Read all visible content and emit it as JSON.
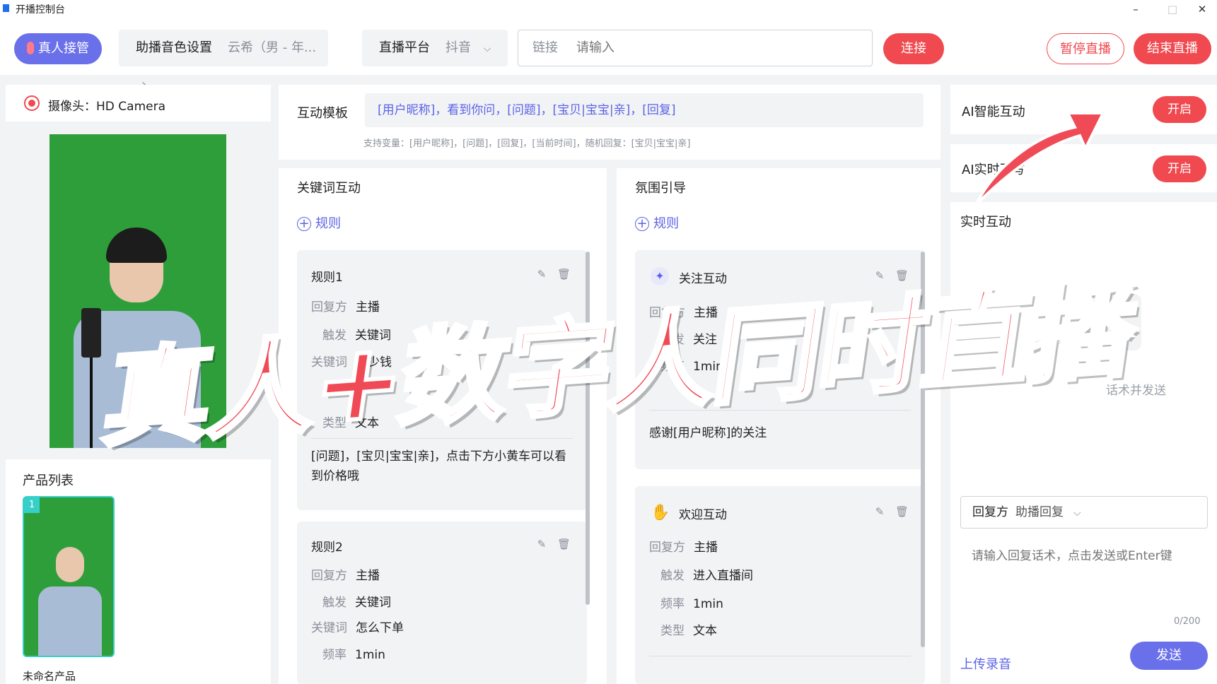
{
  "window": {
    "title": "开播控制台",
    "minimize": "–",
    "maximize": "□",
    "close": "✕"
  },
  "toolbar": {
    "real_person_label": "真人接管",
    "voice_label": "助播音色设置",
    "voice_value": "云希（男 - 年...",
    "platform_label": "直播平台",
    "platform_value": "抖音",
    "link_label": "链接",
    "link_placeholder": "请输入",
    "connect_label": "连接",
    "pause_label": "暂停直播",
    "end_label": "结束直播"
  },
  "camera": {
    "label": "摄像头：HD Camera"
  },
  "products": {
    "title": "产品列表",
    "items": [
      {
        "index": "1",
        "name": "未命名产品"
      }
    ]
  },
  "template": {
    "label": "互动模板",
    "value": "[用户昵称]，看到你问，[问题]，[宝贝|宝宝|亲]，[回复]",
    "hint": "支持变量：[用户昵称]，[问题]，[回复]，[当前时间]，随机回复：[宝贝|宝宝|亲]"
  },
  "keyword": {
    "title": "关键词互动",
    "add_rule": "规则",
    "rules": [
      {
        "title": "规则1",
        "reply_label": "回复方",
        "reply": "主播",
        "trigger_label": "触发",
        "trigger": "关键词",
        "keyword_label": "关键词",
        "keyword": "多少钱",
        "type_label": "类型",
        "type": "文本",
        "content": "[问题]，[宝贝|宝宝|亲]，点击下方小黄车可以看到价格哦"
      },
      {
        "title": "规则2",
        "reply_label": "回复方",
        "reply": "主播",
        "trigger_label": "触发",
        "trigger": "关键词",
        "keyword_label": "关键词",
        "keyword": "怎么下单",
        "freq_label": "频率",
        "freq": "1min"
      }
    ]
  },
  "atmosphere": {
    "title": "氛围引导",
    "add_rule": "规则",
    "cards": [
      {
        "title": "关注互动",
        "icon": "sparkle-icon",
        "reply_label": "回复方",
        "reply": "主播",
        "trigger_label": "触发",
        "trigger": "关注",
        "freq_label": "频率",
        "freq": "1min",
        "content": "感谢[用户昵称]的关注"
      },
      {
        "title": "欢迎互动",
        "icon": "clap-icon",
        "reply_label": "回复方",
        "reply": "主播",
        "trigger_label": "触发",
        "trigger": "进入直播间",
        "freq_label": "频率",
        "freq": "1min",
        "type_label": "类型",
        "type": "文本"
      }
    ]
  },
  "right": {
    "ai_interact": "AI智能互动",
    "ai_rewrite": "AI实时改写",
    "toggle_on": "开启",
    "realtime_title": "实时互动",
    "empty_hint": "话术并发送",
    "reply_select_label": "回复方",
    "reply_select_value": "助播回复",
    "input_placeholder": "请输入回复话术，点击发送或Enter键",
    "counter": "0/200",
    "upload_label": "上传录音",
    "send_label": "发送"
  },
  "overlay": {
    "caption": "真人+数字人同时直播"
  },
  "colors": {
    "accent": "#5b63e6",
    "danger": "#f0494f",
    "green_screen": "#2e9e3a"
  }
}
